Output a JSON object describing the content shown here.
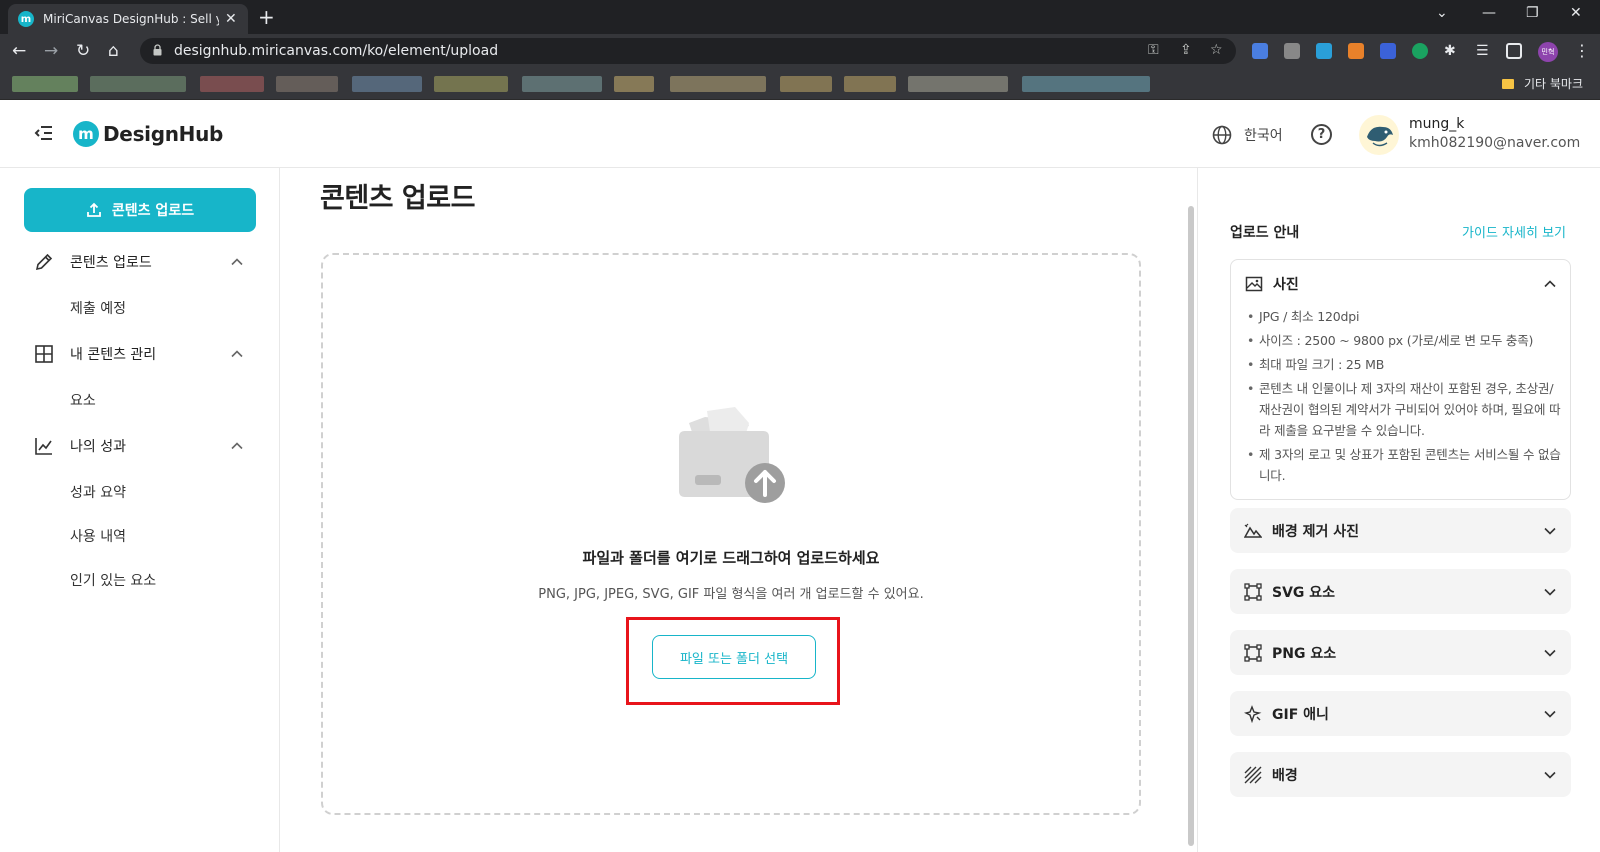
{
  "browser": {
    "tab_title": "MiriCanvas DesignHub : Sell your",
    "tab_favicon": "m",
    "url": "designhub.miricanvas.com/ko/element/upload",
    "profile_label": "민혁",
    "bookmarks_other": "기타 북마크"
  },
  "header": {
    "logo_mark": "m",
    "logo_text": "DesignHub",
    "language": "한국어",
    "help": "?",
    "user_name": "mung_k",
    "user_email": "kmh082190@naver.com"
  },
  "sidebar": {
    "upload_button": "콘텐츠 업로드",
    "groups": [
      {
        "label": "콘텐츠 업로드",
        "icon": "pencil-icon",
        "items": [
          "제출 예정"
        ]
      },
      {
        "label": "내 콘텐츠 관리",
        "icon": "grid-icon",
        "items": [
          "요소"
        ]
      },
      {
        "label": "나의 성과",
        "icon": "chart-icon",
        "items": [
          "성과 요약",
          "사용 내역",
          "인기 있는 요소"
        ]
      }
    ]
  },
  "main": {
    "title": "콘텐츠 업로드",
    "drop_title": "파일과 폴더를 여기로 드래그하여 업로드하세요",
    "drop_sub": "PNG, JPG, JPEG, SVG, GIF 파일 형식을 여러 개 업로드할 수 있어요.",
    "select_button": "파일 또는 폴더 선택"
  },
  "guide": {
    "title": "업로드 안내",
    "link": "가이드 자세히 보기",
    "open_section": {
      "label": "사진",
      "icon": "image-icon",
      "rules": [
        "JPG / 최소 120dpi",
        "사이즈 : 2500 ~ 9800 px (가로/세로 변 모두 충족)",
        "최대 파일 크기 : 25 MB",
        "콘텐츠 내 인물이나 제 3자의 재산이 포함된 경우, 초상권/재산권이 협의된 계약서가 구비되어 있어야 하며, 필요에 따라 제출을 요구받을 수 있습니다.",
        "제 3자의 로고 및 상표가 포함된 콘텐츠는 서비스될 수 없습니다."
      ]
    },
    "closed_sections": [
      {
        "label": "배경 제거 사진",
        "icon": "mountain-icon"
      },
      {
        "label": "SVG 요소",
        "icon": "vector-icon"
      },
      {
        "label": "PNG 요소",
        "icon": "vector-icon"
      },
      {
        "label": "GIF 애니",
        "icon": "sparkle-icon"
      },
      {
        "label": "배경",
        "icon": "pattern-icon"
      }
    ]
  },
  "colors": {
    "accent": "#17b5c9",
    "highlight": "#e8141b"
  }
}
